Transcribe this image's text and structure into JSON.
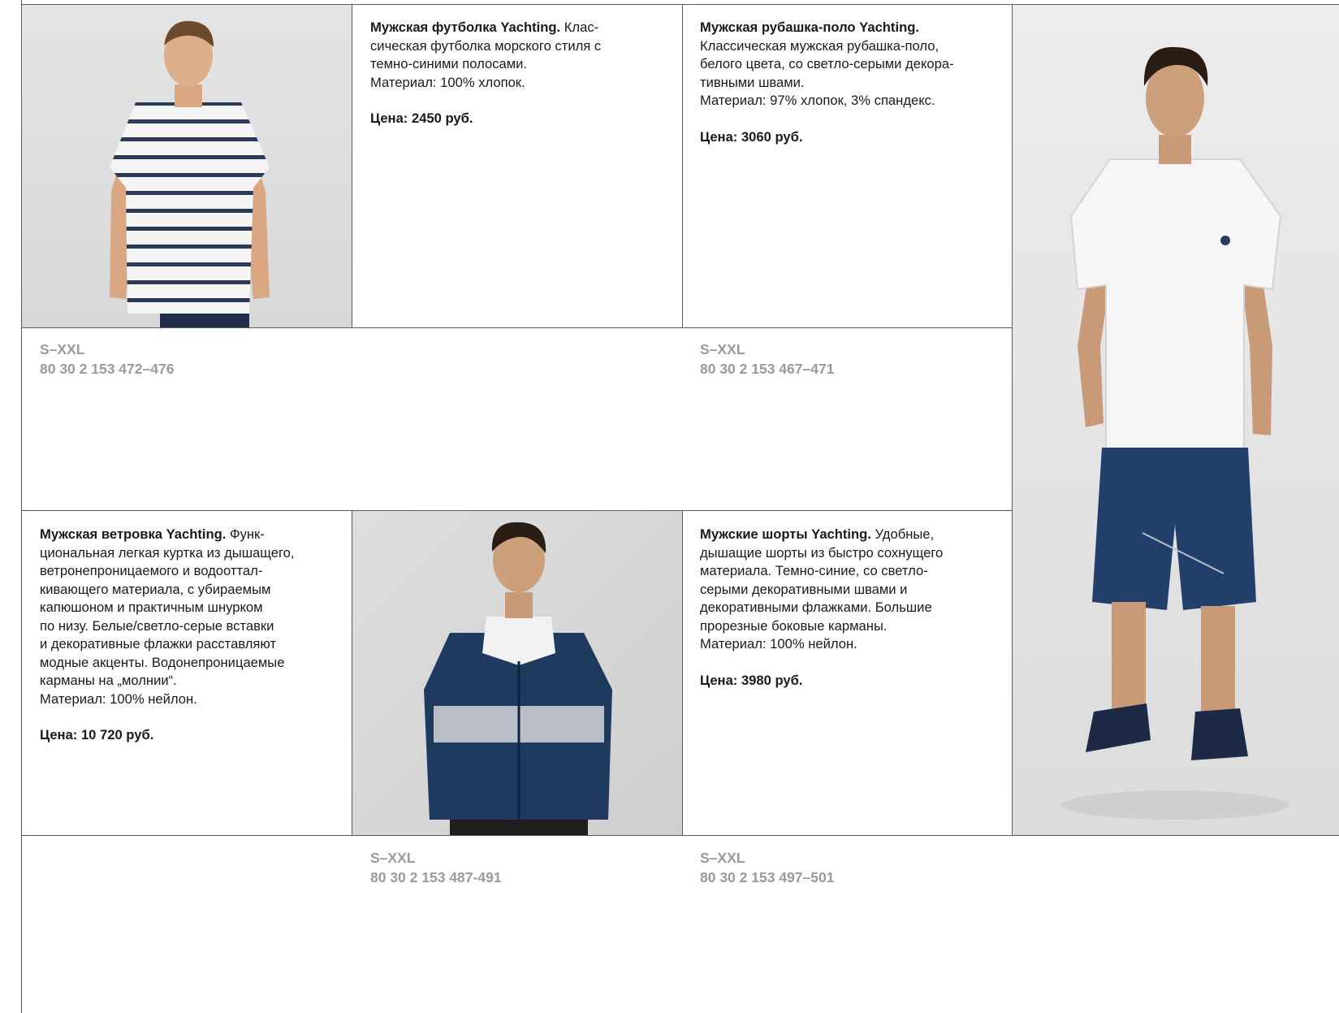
{
  "products": [
    {
      "id": "tshirt",
      "title": "Мужская футболка Yachting.",
      "lines": [
        " Клас-",
        "сическая футболка морского стиля с",
        "темно-синими полосами.",
        "Материал: 100% хлопок."
      ],
      "price": "Цена: 2450 руб.",
      "size": "S–XXL",
      "code": "80 30 2 153 472–476"
    },
    {
      "id": "polo",
      "title": "Мужская рубашка-поло Yachting.",
      "lines": [
        "Классическая мужская рубашка-поло,",
        "белого цвета, со светло-серыми декора-",
        "тивными швами.",
        "Материал: 97% хлопок, 3% спандекс."
      ],
      "price": "Цена: 3060 руб.",
      "size": "S–XXL",
      "code": "80 30 2 153 467–471"
    },
    {
      "id": "jacket",
      "title": "Мужская ветровка Yachting.",
      "lines": [
        " Функ-",
        "циональная легкая куртка из дышащего,",
        "ветронепроницаемого и водооттал-",
        "кивающего материала, с убираемым",
        "капюшоном и практичным шнурком",
        "по низу. Белые/светло-серые вставки",
        "и декоративные флажки расставляют",
        "модные акценты. Водонепроницаемые",
        "карманы на „молнии“.",
        "Материал: 100% нейлон."
      ],
      "price": "Цена: 10 720 руб.",
      "size": "S–XXL",
      "code": "80 30 2 153 487-491"
    },
    {
      "id": "shorts",
      "title": "Мужские шорты Yachting.",
      "lines": [
        " Удобные,",
        "дышащие шорты из быстро сохнущего",
        "материала. Темно-синие, со светло-",
        "серыми декоративными швами и",
        "декоративными флажками. Большие",
        "прорезные боковые карманы.",
        "Материал: 100% нейлон."
      ],
      "price": "Цена: 3980 руб.",
      "size": "S–XXL",
      "code": "80 30 2 153 497–501"
    }
  ],
  "colors": {
    "grid_line": "#5a5a5a",
    "code_text": "#9a9a9a",
    "photo_bg": "#e6e6e6",
    "navy": "#1e3a5f"
  }
}
